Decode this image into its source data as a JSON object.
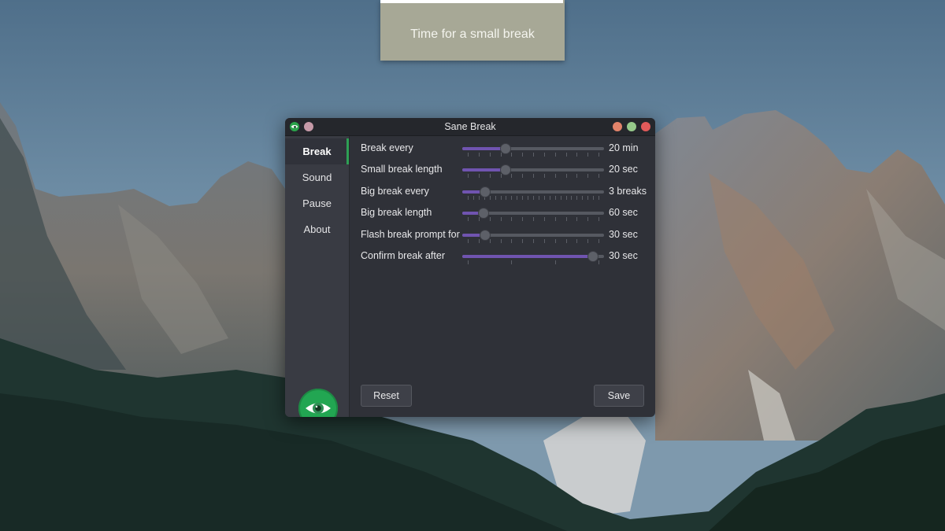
{
  "notification": {
    "text": "Time for a small break",
    "progress": 0.99
  },
  "window": {
    "title": "Sane Break"
  },
  "sidebar": {
    "items": [
      {
        "label": "Break",
        "active": true
      },
      {
        "label": "Sound",
        "active": false
      },
      {
        "label": "Pause",
        "active": false
      },
      {
        "label": "About",
        "active": false
      }
    ]
  },
  "settings": [
    {
      "label": "Break every",
      "value": "20 min",
      "level": 0.29,
      "ticks": 13
    },
    {
      "label": "Small break length",
      "value": "20 sec",
      "level": 0.29,
      "ticks": 13
    },
    {
      "label": "Big break every",
      "value": "3 breaks",
      "level": 0.13,
      "ticks": 25
    },
    {
      "label": "Big break length",
      "value": "60 sec",
      "level": 0.12,
      "ticks": 13
    },
    {
      "label": "Flash break prompt for",
      "value": "30 sec",
      "level": 0.13,
      "ticks": 13
    },
    {
      "label": "Confirm break after",
      "value": "30 sec",
      "level": 0.96,
      "ticks": 4
    }
  ],
  "buttons": {
    "reset": "Reset",
    "save": "Save"
  },
  "colors": {
    "accent": "#7054b0",
    "active_indicator": "#2ea055",
    "app_green": "#22a652"
  },
  "icons": {
    "app": "eye-icon",
    "pin": "pin-icon",
    "minimize": "minimize-icon",
    "maximize": "maximize-icon",
    "close": "close-icon"
  }
}
